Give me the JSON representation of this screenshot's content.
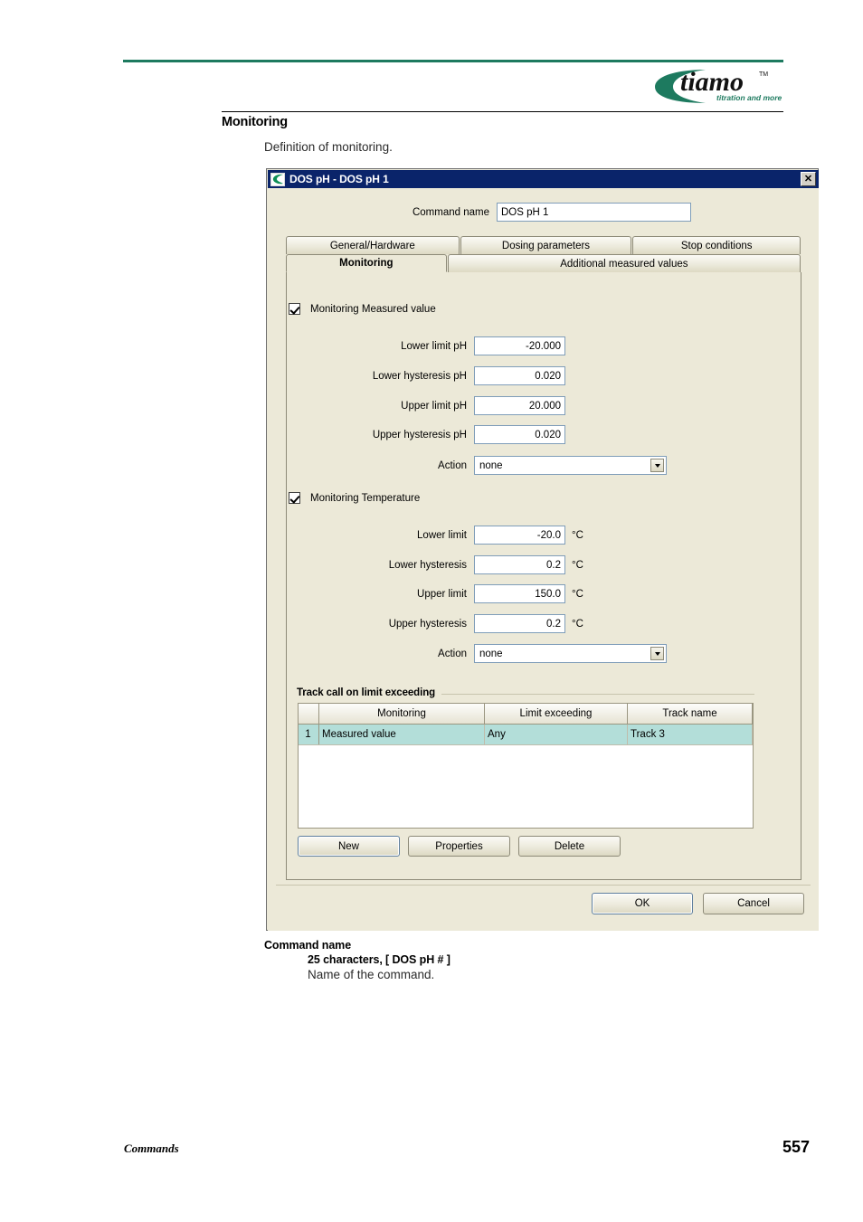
{
  "page": {
    "section_heading": "Monitoring",
    "intro": "Definition of monitoring.",
    "footer_left": "Commands",
    "footer_page": "557"
  },
  "logo": {
    "wordmark": "tiamo",
    "tm": "TM",
    "tagline": "titration and more",
    "green": "#1d7a5f"
  },
  "dialog": {
    "title": "DOS pH - DOS pH 1",
    "close_label": "✕",
    "command_name": {
      "label": "Command name",
      "value": "DOS pH 1"
    },
    "tabs_row1": [
      {
        "label": "General/Hardware",
        "active": false
      },
      {
        "label": "Dosing parameters",
        "active": false
      },
      {
        "label": "Stop conditions",
        "active": false
      }
    ],
    "tabs_row2": [
      {
        "label": "Monitoring",
        "active": true
      },
      {
        "label": "Additional measured values",
        "active": false
      }
    ],
    "measured_value": {
      "checkbox_label": "Monitoring Measured value",
      "checked": true,
      "fields": [
        {
          "label": "Lower limit pH",
          "value": "-20.000"
        },
        {
          "label": "Lower hysteresis pH",
          "value": "0.020"
        },
        {
          "label": "Upper limit pH",
          "value": "20.000"
        },
        {
          "label": "Upper hysteresis pH",
          "value": "0.020"
        }
      ],
      "action": {
        "label": "Action",
        "value": "none"
      }
    },
    "temperature": {
      "checkbox_label": "Monitoring Temperature",
      "checked": true,
      "fields": [
        {
          "label": "Lower limit",
          "value": "-20.0",
          "unit": "°C"
        },
        {
          "label": "Lower hysteresis",
          "value": "0.2",
          "unit": "°C"
        },
        {
          "label": "Upper limit",
          "value": "150.0",
          "unit": "°C"
        },
        {
          "label": "Upper hysteresis",
          "value": "0.2",
          "unit": "°C"
        }
      ],
      "action": {
        "label": "Action",
        "value": "none"
      }
    },
    "track_group": {
      "title": "Track call on limit exceeding",
      "columns": [
        "",
        "Monitoring",
        "Limit exceeding",
        "Track name"
      ],
      "rows": [
        {
          "index": "1",
          "monitoring": "Measured value",
          "limit_exceeding": "Any",
          "track_name": "Track 3",
          "selected": true
        }
      ],
      "buttons": [
        {
          "label": "New",
          "focused": true
        },
        {
          "label": "Properties",
          "focused": false
        },
        {
          "label": "Delete",
          "focused": false
        }
      ],
      "selection_color": "#b3ded9"
    },
    "footer_buttons": [
      {
        "label": "OK",
        "focused": true
      },
      {
        "label": "Cancel",
        "focused": false
      }
    ]
  },
  "caption": {
    "title": "Command name",
    "sub": "25 characters, [ DOS pH # ]",
    "desc": "Name of the command."
  }
}
